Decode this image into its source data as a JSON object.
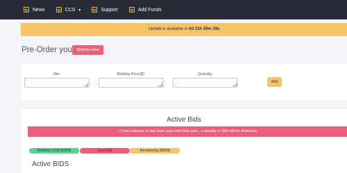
{
  "nav": {
    "items": [
      {
        "label": "News",
        "icon": "news-icon"
      },
      {
        "label": "CCS",
        "icon": "card-icon",
        "dropdown": true
      },
      {
        "label": "Support",
        "icon": "support-icon"
      },
      {
        "label": "Add Funds",
        "icon": "funds-icon"
      }
    ]
  },
  "banner": {
    "prefix": "Update is available in ",
    "countdown": "0d 15h 59m 39s"
  },
  "preorder": {
    "title": "Pre-Order your CC",
    "rules_button": "Bidding rules",
    "fields": [
      {
        "label": "Bin:"
      },
      {
        "label": "Bidding Price($):"
      },
      {
        "label": "Quantity:"
      }
    ],
    "add_button": "Add"
  },
  "bids": {
    "title": "Active Bids",
    "warning": "- If your balance is less than your total bids sum , a penalty of $50 will be deducted.",
    "limit": "Bidding Limit:3000$",
    "used": "Used:0$",
    "remaining": "Remaining:3000$",
    "section_title": "Active BIDS"
  },
  "colors": {
    "topbar": "#262b35",
    "accent_yellow": "#f7c46b",
    "accent_pink": "#e8607a",
    "accent_green": "#5ccf9a"
  }
}
